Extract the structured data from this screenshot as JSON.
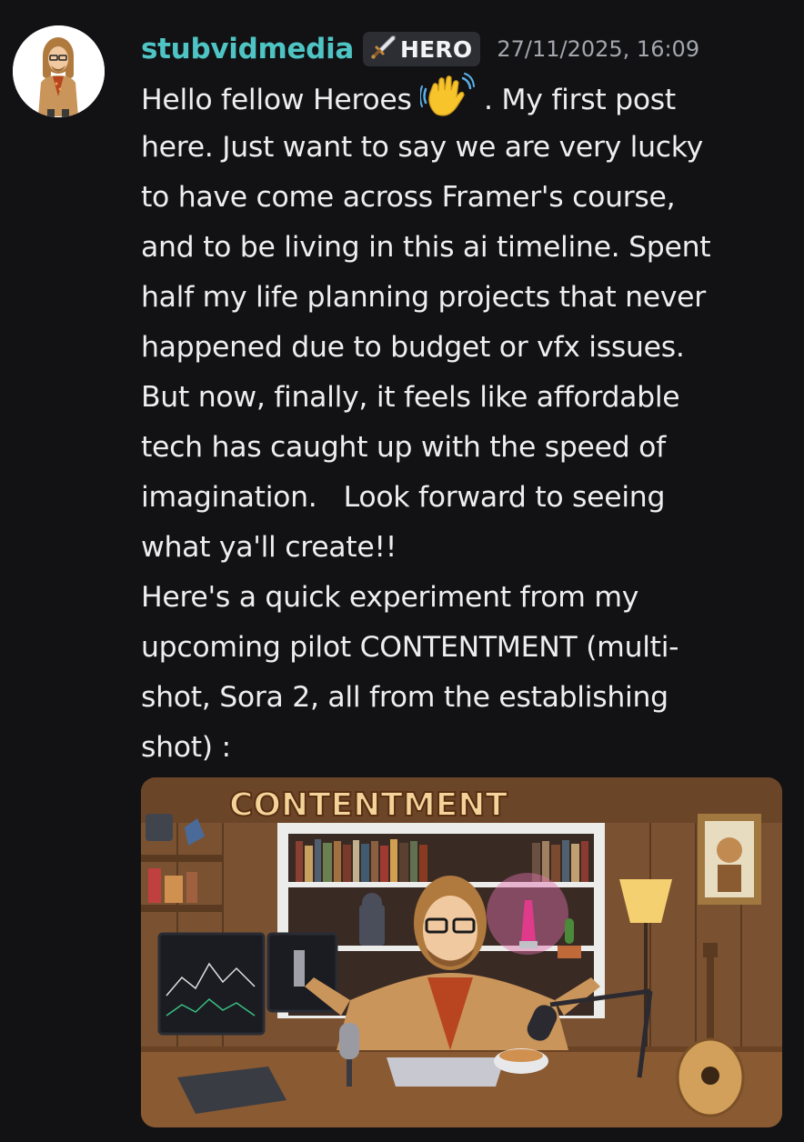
{
  "message": {
    "author": {
      "username": "stubvidmedia",
      "role_badge": "HERO",
      "role_badge_icon": "sword-icon",
      "username_color": "#4fc4c4"
    },
    "timestamp": "27/11/2025, 16:09",
    "lines": [
      {
        "before": "Hello fellow Heroes ",
        "emoji": "waving-hand",
        "after": " . My first post"
      },
      {
        "text": "here. Just want to say we are very lucky"
      },
      {
        "text": "to have come across Framer's course,"
      },
      {
        "text": "and to be living in this ai timeline. Spent"
      },
      {
        "text": "half my life planning projects that never"
      },
      {
        "text": "happened due to budget or vfx issues."
      },
      {
        "text": "But now, finally, it feels like affordable"
      },
      {
        "text": "tech has caught up with the speed of"
      },
      {
        "text": "imagination.   Look forward to seeing"
      },
      {
        "text": "what ya'll create!!"
      },
      {
        "text": "Here's a quick experiment from my"
      },
      {
        "text": "upcoming pilot CONTENTMENT (multi-"
      },
      {
        "text": "shot, Sora 2, all from the establishing"
      },
      {
        "text": "shot) :"
      }
    ],
    "attachment": {
      "type": "image",
      "sign_text": "CONTENTMENT"
    }
  }
}
